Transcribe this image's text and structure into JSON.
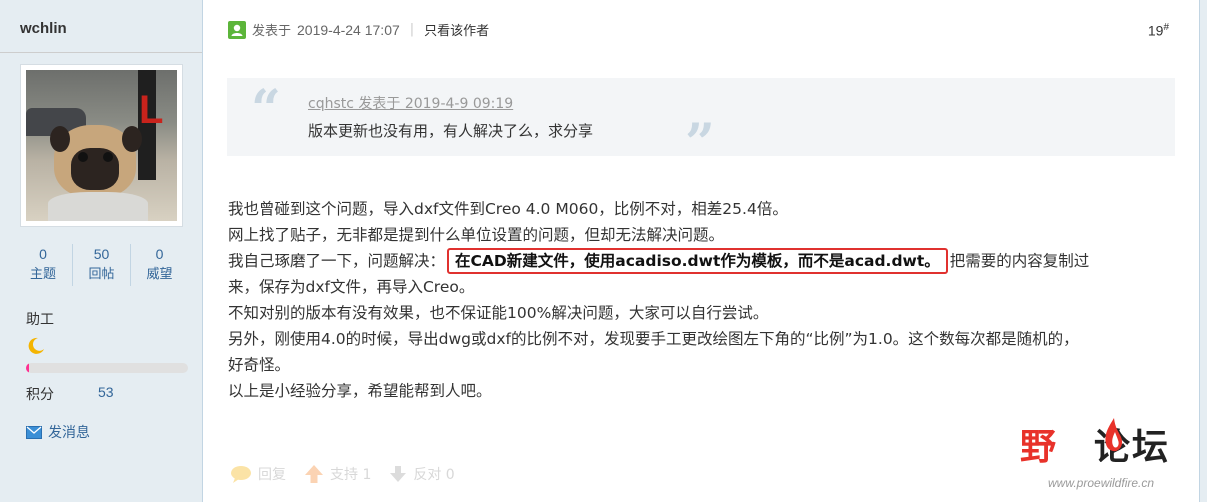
{
  "author": {
    "name": "wchlin",
    "stats": [
      {
        "value": "0",
        "label": "主题"
      },
      {
        "value": "50",
        "label": "回帖"
      },
      {
        "value": "0",
        "label": "威望"
      }
    ],
    "rank": "助工",
    "rank_icon": "moon-icon",
    "progress_fraction": 0.02,
    "points_label": "积分",
    "points_value": "53",
    "send_message_label": "发消息"
  },
  "post": {
    "posted_label": "发表于",
    "timestamp": "2019-4-24 17:07",
    "separator": "|",
    "only_author_label": "只看该作者",
    "floor_number": "19",
    "floor_suffix": "#",
    "quote": {
      "author_line": "cqhstc 发表于 2019-4-9 09:19",
      "text": "版本更新也没有用，有人解决了么，求分享"
    },
    "content": {
      "line1": "我也曾碰到这个问题，导入dxf文件到Creo 4.0 M060，比例不对，相差25.4倍。",
      "line2": "网上找了贴子，无非都是提到什么单位设置的问题，但却无法解决问题。",
      "line3_prefix": "我自己琢磨了一下，问题解决：",
      "line3_highlight": "在CAD新建文件，使用acadiso.dwt作为模板，而不是acad.dwt。",
      "line3_suffix": "把需要的内容复制过",
      "line4": "来，保存为dxf文件，再导入Creo。",
      "line5": "不知对别的版本有没有效果，也不保证能100%解决问题，大家可以自行尝试。",
      "line6": "另外，刚使用4.0的时候，导出dwg或dxf的比例不对，发现要手工更改绘图左下角的“比例”为1.0。这个数每次都是随机的，",
      "line7": "好奇怪。",
      "line8": "以上是小经验分享，希望能帮到人吧。"
    },
    "actions": {
      "reply_label": "回复",
      "support_label": "支持 1",
      "oppose_label": "反对 0"
    }
  },
  "watermark": {
    "logo_text_part1": "野",
    "logo_text_part2": "论坛",
    "url": "www.proewildfire.cn"
  },
  "colors": {
    "sidebar_bg": "#e5edf2",
    "link_blue": "#336699",
    "highlight_border": "#e0312f",
    "progress_fill": "#ff2f92",
    "quote_bg": "#f3f5f7"
  }
}
